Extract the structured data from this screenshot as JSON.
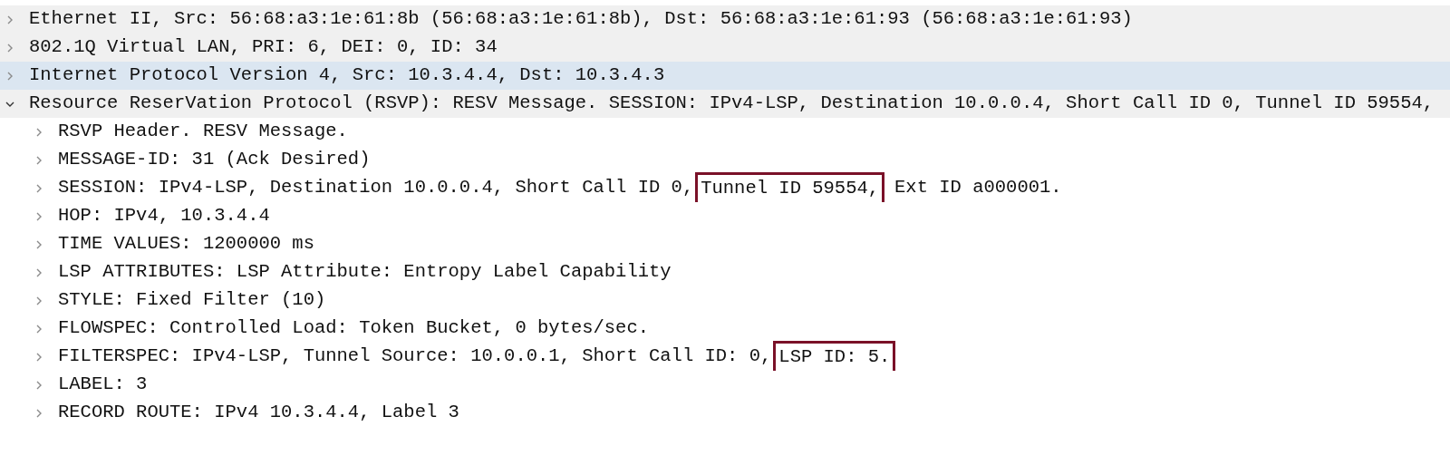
{
  "tree": [
    {
      "segments": [
        {
          "text": "Ethernet II, Src: 56:68:a3:1e:61:8b (56:68:a3:1e:61:8b), Dst: 56:68:a3:1e:61:93 (56:68:a3:1e:61:93)",
          "boxed": false
        }
      ],
      "expanded": false,
      "selected": false
    },
    {
      "segments": [
        {
          "text": "802.1Q Virtual LAN, PRI: 6, DEI: 0, ID: 34",
          "boxed": false
        }
      ],
      "expanded": false,
      "selected": false
    },
    {
      "segments": [
        {
          "text": "Internet Protocol Version 4, Src: 10.3.4.4, Dst: 10.3.4.3",
          "boxed": false
        }
      ],
      "expanded": false,
      "selected": true
    },
    {
      "segments": [
        {
          "text": "Resource ReserVation Protocol (RSVP): RESV Message. SESSION: IPv4-LSP, Destination 10.0.0.4, Short Call ID 0, Tunnel ID 59554,",
          "boxed": false
        }
      ],
      "expanded": true,
      "selected": false,
      "children": [
        {
          "segments": [
            {
              "text": "RSVP Header. RESV Message.",
              "boxed": false
            }
          ],
          "expanded": false,
          "selected": false
        },
        {
          "segments": [
            {
              "text": "MESSAGE-ID: 31 (Ack Desired)",
              "boxed": false
            }
          ],
          "expanded": false,
          "selected": false
        },
        {
          "segments": [
            {
              "text": "SESSION: IPv4-LSP, Destination 10.0.0.4, Short Call ID 0,",
              "boxed": false
            },
            {
              "text": "Tunnel ID 59554,",
              "boxed": true
            },
            {
              "text": "Ext ID a000001.",
              "boxed": false
            }
          ],
          "expanded": false,
          "selected": false
        },
        {
          "segments": [
            {
              "text": "HOP: IPv4, 10.3.4.4",
              "boxed": false
            }
          ],
          "expanded": false,
          "selected": false
        },
        {
          "segments": [
            {
              "text": "TIME VALUES: 1200000 ms",
              "boxed": false
            }
          ],
          "expanded": false,
          "selected": false
        },
        {
          "segments": [
            {
              "text": "LSP ATTRIBUTES: LSP Attribute: Entropy Label Capability",
              "boxed": false
            }
          ],
          "expanded": false,
          "selected": false
        },
        {
          "segments": [
            {
              "text": "STYLE: Fixed Filter (10)",
              "boxed": false
            }
          ],
          "expanded": false,
          "selected": false
        },
        {
          "segments": [
            {
              "text": "FLOWSPEC: Controlled Load: Token Bucket, 0 bytes/sec.",
              "boxed": false
            }
          ],
          "expanded": false,
          "selected": false
        },
        {
          "segments": [
            {
              "text": "FILTERSPEC: IPv4-LSP, Tunnel Source: 10.0.0.1, Short Call ID: 0,",
              "boxed": false
            },
            {
              "text": "LSP ID: 5.",
              "boxed": true
            }
          ],
          "expanded": false,
          "selected": false
        },
        {
          "segments": [
            {
              "text": "LABEL: 3",
              "boxed": false
            }
          ],
          "expanded": false,
          "selected": false
        },
        {
          "segments": [
            {
              "text": "RECORD ROUTE: IPv4 10.3.4.4, Label 3",
              "boxed": false
            }
          ],
          "expanded": false,
          "selected": false
        }
      ]
    }
  ]
}
